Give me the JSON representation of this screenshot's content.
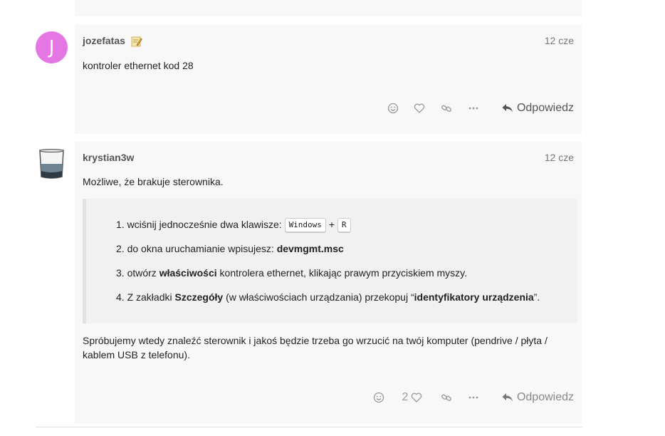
{
  "posts": [
    {
      "avatar_letter": "J",
      "username": "jozefatas",
      "date": "12 cze",
      "text": "kontroler ethernet kod 28",
      "reply_label": "Odpowiedz"
    },
    {
      "username": "krystian3w",
      "date": "12 cze",
      "intro": "Możliwe, że brakuje sterownika.",
      "steps": {
        "s1_prefix": "1. wciśnij jednocześnie dwa klawisze:",
        "s1_key1": "Windows",
        "s1_plus": "+",
        "s1_key2": "R",
        "s2_prefix": "2. do okna uruchamianie wpisujesz:",
        "s2_bold": "devmgmt.msc",
        "s3_prefix": "3. otwórz",
        "s3_bold": "właściwości",
        "s3_suffix": "kontrolera ethernet, klikając prawym przyciskiem myszy.",
        "s4_prefix": "4. Z zakładki",
        "s4_bold1": "Szczegóły",
        "s4_mid": "(w właściwościach urządzania) przekopuj “",
        "s4_bold2": "identyfikatory urządzenia",
        "s4_suffix": "”."
      },
      "outro_line1": "Spróbujemy wtedy znaleźć sterownik i jakoś będzie trzeba go wrzucić na twój komputer (pendrive / płyta /",
      "outro_line2": "kablem USB z telefonu).",
      "like_count": "2",
      "reply_label": "Odpowiedz"
    }
  ],
  "icons": {
    "emoji": "smile-icon",
    "like": "heart-icon",
    "link": "link-icon",
    "more": "more-icon",
    "reply": "reply-arrow-icon"
  },
  "colors": {
    "avatar_j": "#e477e4",
    "post_bg": "#f8f8f8"
  }
}
